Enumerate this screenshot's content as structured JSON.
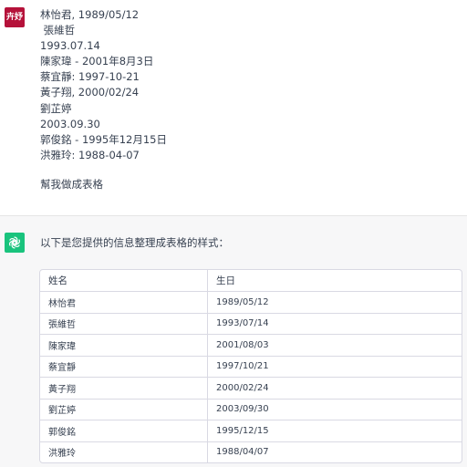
{
  "user": {
    "avatar_text": "卉妤",
    "lines": [
      "林怡君, 1989/05/12",
      " 張維哲",
      "1993.07.14",
      "陳家瑋 - 2001年8月3日",
      "蔡宜靜: 1997-10-21",
      "黃子翔, 2000/02/24",
      "劉芷婷",
      "2003.09.30",
      "郭俊銘 - 1995年12月15日",
      "洪雅玲: 1988-04-07"
    ],
    "request": "幫我做成表格"
  },
  "assistant": {
    "avatar_icon": "openai-logo-icon",
    "intro": "以下是您提供的信息整理成表格的样式：",
    "table": {
      "headers": [
        "姓名",
        "生日"
      ],
      "rows": [
        [
          "林怡君",
          "1989/05/12"
        ],
        [
          "張維哲",
          "1993/07/14"
        ],
        [
          "陳家瑋",
          "2001/08/03"
        ],
        [
          "蔡宜靜",
          "1997/10/21"
        ],
        [
          "黃子翔",
          "2000/02/24"
        ],
        [
          "劉芷婷",
          "2003/09/30"
        ],
        [
          "郭俊銘",
          "1995/12/15"
        ],
        [
          "洪雅玲",
          "1988/04/07"
        ]
      ]
    }
  },
  "colors": {
    "user_avatar_bg": "#b5123a",
    "assistant_avatar_bg": "#19c37d",
    "assistant_bg": "#f7f7f8"
  }
}
